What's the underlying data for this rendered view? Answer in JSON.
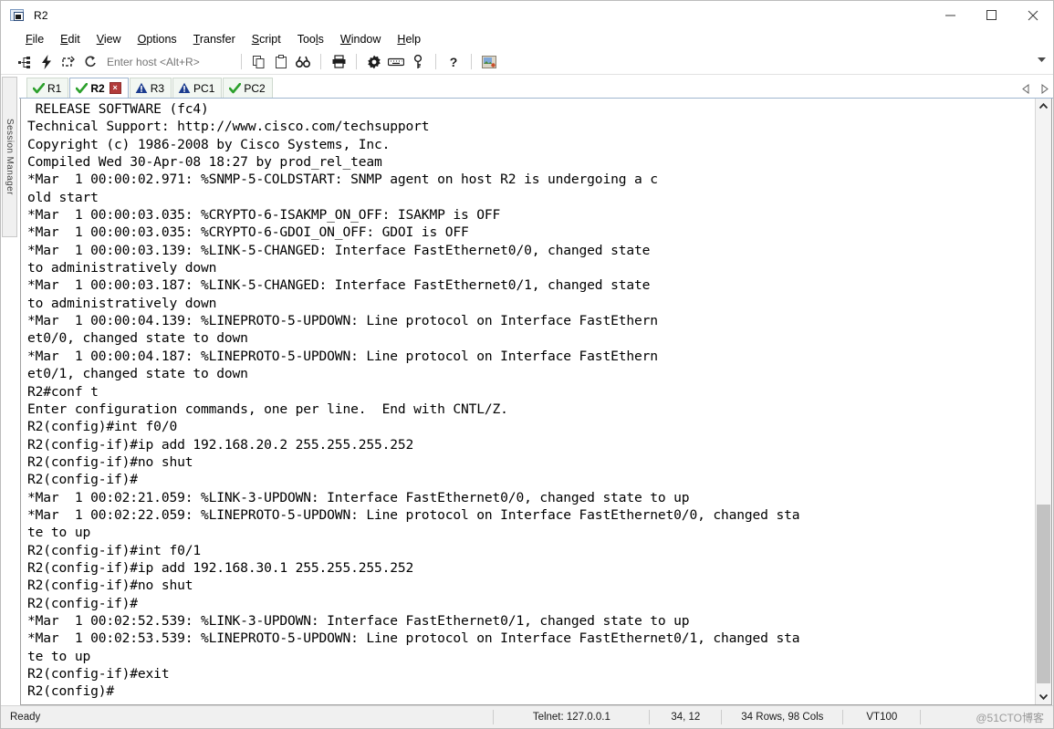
{
  "window": {
    "title": "R2",
    "icon": "terminal-window-icon",
    "minimize_label": "–",
    "maximize_label": "□",
    "close_label": "×"
  },
  "menubar": {
    "items": [
      {
        "label": "File",
        "mnemonic": "F"
      },
      {
        "label": "Edit",
        "mnemonic": "E"
      },
      {
        "label": "View",
        "mnemonic": "V"
      },
      {
        "label": "Options",
        "mnemonic": "O"
      },
      {
        "label": "Transfer",
        "mnemonic": "T"
      },
      {
        "label": "Script",
        "mnemonic": "S"
      },
      {
        "label": "Tools",
        "mnemonic": "l"
      },
      {
        "label": "Window",
        "mnemonic": "W"
      },
      {
        "label": "Help",
        "mnemonic": "H"
      }
    ]
  },
  "toolbar": {
    "host_placeholder": "Enter host <Alt+R>",
    "host_value": "",
    "icons_left": [
      "connect-icon",
      "quick-connect-icon",
      "clone-session-icon",
      "reconnect-icon"
    ],
    "icons_mid": [
      "copy-icon",
      "paste-icon",
      "find-icon"
    ],
    "icons_print": [
      "print-icon"
    ],
    "icons_right": [
      "settings-gear-icon",
      "keyboard-icon",
      "key-icon"
    ],
    "icons_help": [
      "help-icon"
    ],
    "icons_end": [
      "session-options-icon"
    ],
    "overflow_label": "▾"
  },
  "session_rail": {
    "label": "Session Manager"
  },
  "tabs": {
    "items": [
      {
        "label": "R1",
        "status": "connected",
        "active": false,
        "closable": false
      },
      {
        "label": "R2",
        "status": "connected",
        "active": true,
        "closable": true,
        "close_label": "×"
      },
      {
        "label": "R3",
        "status": "warning",
        "active": false,
        "closable": false
      },
      {
        "label": "PC1",
        "status": "warning",
        "active": false,
        "closable": false
      },
      {
        "label": "PC2",
        "status": "connected",
        "active": false,
        "closable": false
      }
    ],
    "nav_prev": "◁",
    "nav_next": "▷"
  },
  "terminal": {
    "lines": [
      " RELEASE SOFTWARE (fc4)",
      "Technical Support: http://www.cisco.com/techsupport",
      "Copyright (c) 1986-2008 by Cisco Systems, Inc.",
      "Compiled Wed 30-Apr-08 18:27 by prod_rel_team",
      "*Mar  1 00:00:02.971: %SNMP-5-COLDSTART: SNMP agent on host R2 is undergoing a c",
      "old start",
      "*Mar  1 00:00:03.035: %CRYPTO-6-ISAKMP_ON_OFF: ISAKMP is OFF",
      "*Mar  1 00:00:03.035: %CRYPTO-6-GDOI_ON_OFF: GDOI is OFF",
      "*Mar  1 00:00:03.139: %LINK-5-CHANGED: Interface FastEthernet0/0, changed state",
      "to administratively down",
      "*Mar  1 00:00:03.187: %LINK-5-CHANGED: Interface FastEthernet0/1, changed state",
      "to administratively down",
      "*Mar  1 00:00:04.139: %LINEPROTO-5-UPDOWN: Line protocol on Interface FastEthern",
      "et0/0, changed state to down",
      "*Mar  1 00:00:04.187: %LINEPROTO-5-UPDOWN: Line protocol on Interface FastEthern",
      "et0/1, changed state to down",
      "R2#conf t",
      "Enter configuration commands, one per line.  End with CNTL/Z.",
      "R2(config)#int f0/0",
      "R2(config-if)#ip add 192.168.20.2 255.255.255.252",
      "R2(config-if)#no shut",
      "R2(config-if)#",
      "*Mar  1 00:02:21.059: %LINK-3-UPDOWN: Interface FastEthernet0/0, changed state to up",
      "*Mar  1 00:02:22.059: %LINEPROTO-5-UPDOWN: Line protocol on Interface FastEthernet0/0, changed sta",
      "te to up",
      "R2(config-if)#int f0/1",
      "R2(config-if)#ip add 192.168.30.1 255.255.255.252",
      "R2(config-if)#no shut",
      "R2(config-if)#",
      "*Mar  1 00:02:52.539: %LINK-3-UPDOWN: Interface FastEthernet0/1, changed state to up",
      "*Mar  1 00:02:53.539: %LINEPROTO-5-UPDOWN: Line protocol on Interface FastEthernet0/1, changed sta",
      "te to up",
      "R2(config-if)#exit",
      "R2(config)#"
    ],
    "scrollbar": {
      "up_arrow": "▲",
      "down_arrow": "▼",
      "thumb_top_pct": 68,
      "thumb_height_pct": 31
    }
  },
  "statusbar": {
    "ready": "Ready",
    "connection": "Telnet: 127.0.0.1",
    "cursor": "34, 12",
    "dimensions": "34 Rows, 98 Cols",
    "emulation": "VT100",
    "trailing": "",
    "watermark": "@51CTO博客"
  },
  "colors": {
    "accent": "#9fb6cf",
    "tab_ok": "#2ca02c",
    "tab_warn": "#1b3c8f",
    "close_red": "#b23b3b",
    "terminal_bg": "#ffffff",
    "terminal_fg": "#000000"
  }
}
